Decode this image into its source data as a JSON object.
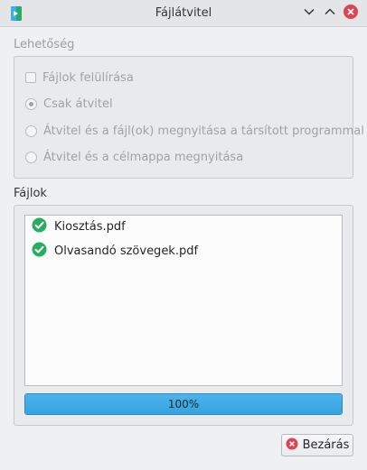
{
  "window": {
    "title": "Fájlátvitel",
    "icon": "app-icon",
    "controls": [
      "chevron-down-icon",
      "chevron-up-icon",
      "close-icon"
    ]
  },
  "options": {
    "title": "Lehetőség",
    "overwrite_label": "Fájlok felülírása",
    "overwrite_checked": false,
    "radios": [
      {
        "label": "Csak átvitel",
        "selected": true
      },
      {
        "label": "Átvitel és a fájl(ok) megnyitása a társított programmal",
        "selected": false
      },
      {
        "label": "Átvitel és a célmappa megnyitása",
        "selected": false
      }
    ],
    "enabled": false
  },
  "files": {
    "title": "Fájlok",
    "items": [
      {
        "name": "Kiosztás.pdf",
        "status_icon": "check-circle-icon"
      },
      {
        "name": "Olvasandó szövegek.pdf",
        "status_icon": "check-circle-icon"
      }
    ],
    "progress": {
      "value": 100,
      "text": "100%"
    }
  },
  "footer": {
    "close_label": "Bezárás",
    "close_icon": "cancel-icon"
  },
  "colors": {
    "progress": "#3daee9",
    "success": "#27ae60",
    "close": "#da4453"
  }
}
